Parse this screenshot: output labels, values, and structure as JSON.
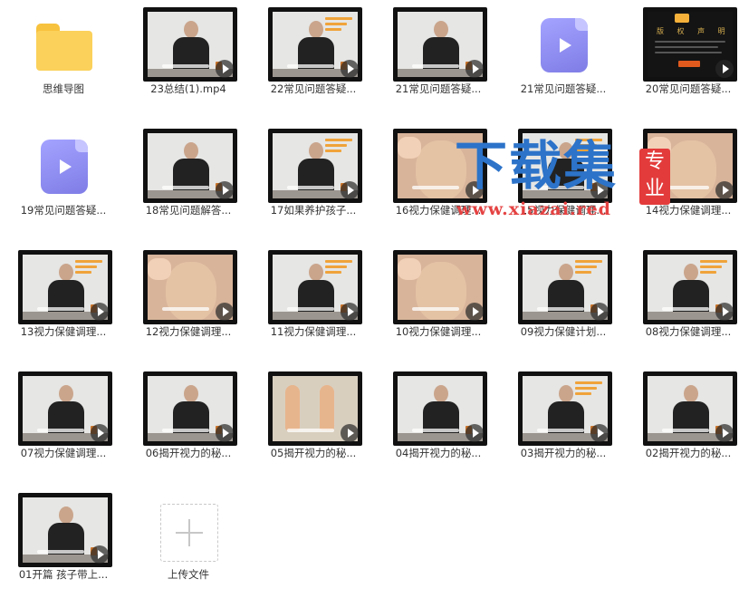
{
  "files": [
    {
      "name": "思维导图",
      "type": "folder",
      "icon": "folder-icon"
    },
    {
      "name": "23总结(1).mp4",
      "type": "video-thumb",
      "style": "speaker"
    },
    {
      "name": "22常见问题答疑...",
      "type": "video-thumb",
      "style": "speaker-text"
    },
    {
      "name": "21常见问题答疑...",
      "type": "video-thumb",
      "style": "speaker"
    },
    {
      "name": "21常见问题答疑...",
      "type": "video-icon",
      "icon": "video-file-icon"
    },
    {
      "name": "20常见问题答疑...",
      "type": "video-thumb",
      "style": "notice"
    },
    {
      "name": "19常见问题答疑...",
      "type": "video-icon",
      "icon": "video-file-icon"
    },
    {
      "name": "18常见问题解答...",
      "type": "video-thumb",
      "style": "speaker"
    },
    {
      "name": "17如果养护孩子...",
      "type": "video-thumb",
      "style": "speaker-text"
    },
    {
      "name": "16视力保健调理...",
      "type": "video-thumb",
      "style": "face"
    },
    {
      "name": "15视力保健调理...",
      "type": "video-thumb",
      "style": "speaker-text"
    },
    {
      "name": "14视力保健调理...",
      "type": "video-thumb",
      "style": "face"
    },
    {
      "name": "13视力保健调理...",
      "type": "video-thumb",
      "style": "speaker-text"
    },
    {
      "name": "12视力保健调理...",
      "type": "video-thumb",
      "style": "face"
    },
    {
      "name": "11视力保健调理...",
      "type": "video-thumb",
      "style": "speaker-text"
    },
    {
      "name": "10视力保健调理...",
      "type": "video-thumb",
      "style": "face"
    },
    {
      "name": "09视力保健计划...",
      "type": "video-thumb",
      "style": "speaker-text"
    },
    {
      "name": "08视力保健调理...",
      "type": "video-thumb",
      "style": "speaker-text"
    },
    {
      "name": "07视力保健调理...",
      "type": "video-thumb",
      "style": "speaker"
    },
    {
      "name": "06揭开视力的秘...",
      "type": "video-thumb",
      "style": "speaker"
    },
    {
      "name": "05揭开视力的秘...",
      "type": "video-thumb",
      "style": "diagram"
    },
    {
      "name": "04揭开视力的秘...",
      "type": "video-thumb",
      "style": "speaker"
    },
    {
      "name": "03揭开视力的秘...",
      "type": "video-thumb",
      "style": "speaker-text"
    },
    {
      "name": "02揭开视力的秘...",
      "type": "video-thumb",
      "style": "speaker"
    },
    {
      "name": "01开篇 孩子带上...",
      "type": "video-thumb",
      "style": "speaker"
    },
    {
      "name": "上传文件",
      "type": "upload",
      "icon": "plus-icon"
    }
  ],
  "notice_thumb": {
    "title": "版 权 声 明"
  },
  "watermark": {
    "text": "下载集",
    "seal": "专业",
    "url": "www.xiazai.red"
  },
  "colors": {
    "folder": "#fbd15b",
    "video_icon": "#8f8ef3",
    "watermark_blue": "#2c73c9",
    "watermark_red": "#e54343"
  }
}
